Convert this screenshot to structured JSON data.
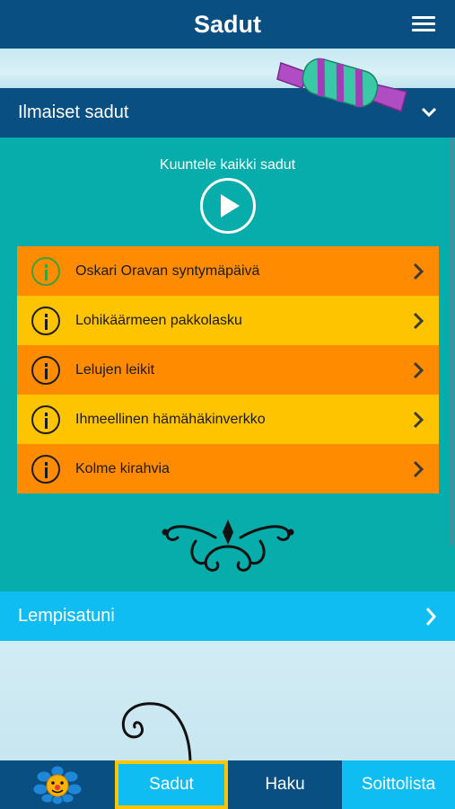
{
  "header": {
    "title": "Sadut",
    "menu_icon": "hamburger-menu-icon"
  },
  "free_stories": {
    "label": "Ilmaiset sadut",
    "listen_all_label": "Kuuntele kaikki sadut",
    "stories": [
      {
        "title": "Oskari Oravan syntymäpäivä",
        "color": "#ff8c00",
        "info_color": "#3aa33a"
      },
      {
        "title": "Lohikäärmeen pakkolasku",
        "color": "#ffc400",
        "info_color": "#1c1c1c"
      },
      {
        "title": "Lelujen leikit",
        "color": "#ff8c00",
        "info_color": "#1c1c1c"
      },
      {
        "title": "Ihmeellinen hämähäkinverkko",
        "color": "#ffc400",
        "info_color": "#1c1c1c"
      },
      {
        "title": "Kolme kirahvia",
        "color": "#ff8c00",
        "info_color": "#1c1c1c"
      }
    ]
  },
  "favourites": {
    "label": "Lempisatuni"
  },
  "bottom_nav": {
    "items": [
      {
        "label": "",
        "icon": "flower-logo-icon"
      },
      {
        "label": "Sadut",
        "active": true
      },
      {
        "label": "Haku"
      },
      {
        "label": "Soittolista"
      }
    ]
  },
  "colors": {
    "dark_blue": "#0a4f82",
    "teal": "#07adab",
    "orange": "#ff8c00",
    "yellow": "#ffc400",
    "light_blue": "#10bdf3"
  }
}
